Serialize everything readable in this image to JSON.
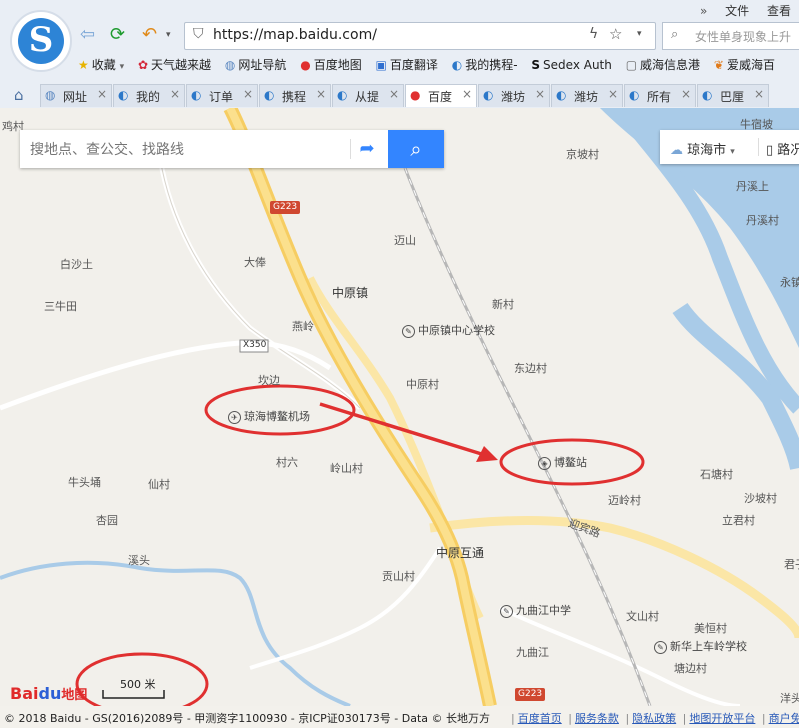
{
  "browser": {
    "menu": [
      "文件",
      "查看"
    ],
    "url": "https://map.baidu.com/",
    "search_placeholder": "女性单身现象上升",
    "bookmarks": [
      {
        "icon": "star-icon",
        "label": "收藏"
      },
      {
        "icon": "flower-icon",
        "label": "天气越来越"
      },
      {
        "icon": "globe-icon",
        "label": "网址导航"
      },
      {
        "icon": "pin-icon",
        "label": "百度地图"
      },
      {
        "icon": "translate-icon",
        "label": "百度翻译"
      },
      {
        "icon": "ctrip-icon",
        "label": "我的携程-"
      },
      {
        "icon": "sedex-icon",
        "label": "Sedex Auth"
      },
      {
        "icon": "page-icon",
        "label": "威海信息港"
      },
      {
        "icon": "leaf-icon",
        "label": "爱威海百"
      }
    ],
    "tabs": [
      "网址",
      "我的",
      "订单",
      "携程",
      "从提",
      "百度",
      "潍坊",
      "潍坊",
      "所有",
      "巴厘"
    ],
    "active_tab": 5
  },
  "map": {
    "search_placeholder": "搜地点、查公交、找路线",
    "city": "琼海市",
    "traffic_label": "路况",
    "scale": "500 米",
    "road_labels": [
      "G223",
      "X350",
      "G223",
      "迎宾路"
    ],
    "place_labels": [
      "鸡村",
      "京坡村",
      "牛宿坡",
      "丹溪上",
      "丹溪村",
      "永镇",
      "迈山",
      "白沙土",
      "大俸",
      "三牛田",
      "新村",
      "燕岭",
      "东边村",
      "坎边",
      "中原村",
      "村六",
      "岭山村",
      "牛头埇",
      "仙村",
      "杏园",
      "溪头",
      "贡山村",
      "石塘村",
      "沙坡村",
      "迈岭村",
      "立君村",
      "君子",
      "文山村",
      "美恒村",
      "塘边村",
      "九曲江",
      "洋头"
    ],
    "town_labels": [
      "中原镇",
      "中原互通"
    ],
    "pois": [
      {
        "name": "中原镇中心学校",
        "icon": "school-icon"
      },
      {
        "name": "琼海博鳌机场",
        "icon": "airport-icon"
      },
      {
        "name": "博鳌站",
        "icon": "train-station-icon"
      },
      {
        "name": "九曲江中学",
        "icon": "school-icon"
      },
      {
        "name": "新华上车岭学校",
        "icon": "school-icon"
      }
    ]
  },
  "footer": {
    "copyright": "© 2018 Baidu - GS(2016)2089号 - 甲测资字1100930 - 京ICP证030173号 - Data © 长地万方",
    "links": [
      "百度首页",
      "服务条款",
      "隐私政策",
      "地图开放平台",
      "商户免"
    ]
  },
  "colors": {
    "accent_blue": "#3385ff",
    "annotation_red": "#e03030",
    "highway_yellow": "#f6cd62",
    "river_blue": "#a9cbe8"
  }
}
